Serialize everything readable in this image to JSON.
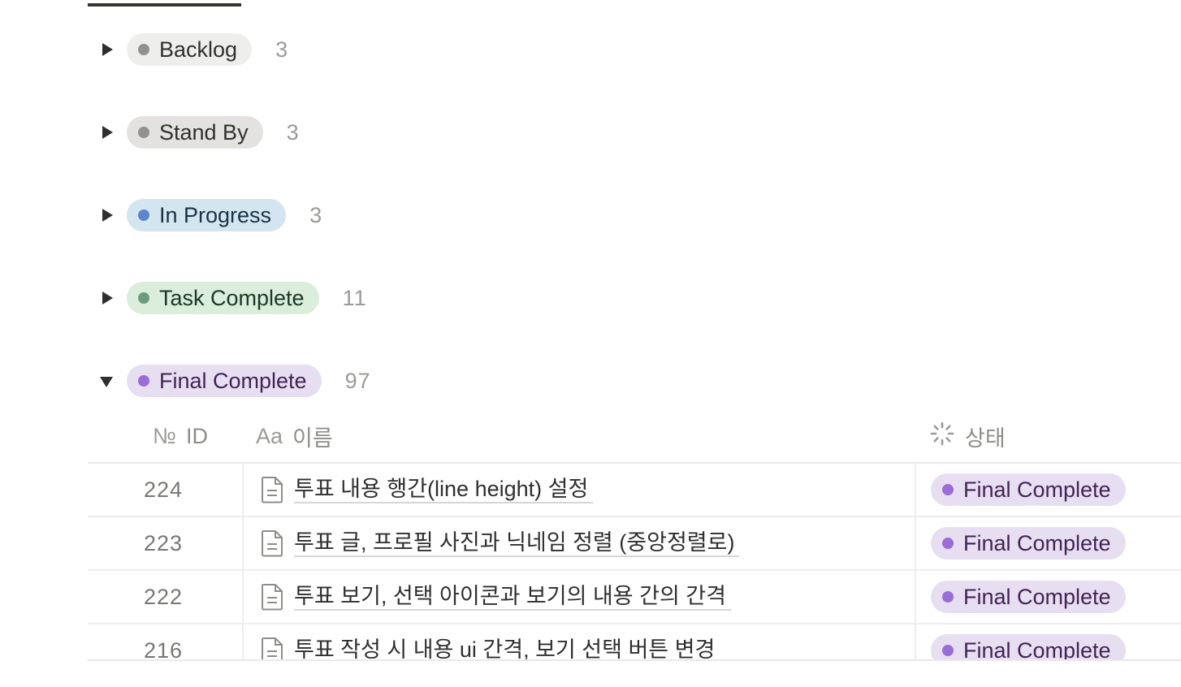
{
  "groups": [
    {
      "label": "Backlog",
      "count": "3",
      "expanded": false,
      "bg": "#eeeeec",
      "dot": "#91918e",
      "text": "#32302c"
    },
    {
      "label": "Stand By",
      "count": "3",
      "expanded": false,
      "bg": "#e3e2e0",
      "dot": "#91918e",
      "text": "#32302c"
    },
    {
      "label": "In Progress",
      "count": "3",
      "expanded": false,
      "bg": "#d3e5ef",
      "dot": "#5e87c9",
      "text": "#183347"
    },
    {
      "label": "Task Complete",
      "count": "11",
      "expanded": false,
      "bg": "#dbeddb",
      "dot": "#6c9b7d",
      "text": "#1c3829"
    },
    {
      "label": "Final Complete",
      "count": "97",
      "expanded": true,
      "bg": "#e8def2",
      "dot": "#9a6dd7",
      "text": "#412454"
    }
  ],
  "table": {
    "columns": {
      "id": {
        "icon": "№",
        "label": "ID"
      },
      "name": {
        "icon": "Aa",
        "label": "이름"
      },
      "status": {
        "icon": "status-spinner-icon",
        "label": "상태"
      }
    },
    "rows": [
      {
        "id": "224",
        "title": "투표 내용 행간(line height) 설정",
        "status": "Final Complete"
      },
      {
        "id": "223",
        "title": "투표 글, 프로필 사진과 닉네임 정렬 (중앙정렬로)",
        "status": "Final Complete"
      },
      {
        "id": "222",
        "title": "투표 보기, 선택 아이콘과 보기의 내용 간의 간격",
        "status": "Final Complete"
      },
      {
        "id": "216",
        "title": "투표 작성 시 내용 ui 간격, 보기 선택 버튼 변경",
        "status": "Final Complete"
      }
    ]
  }
}
